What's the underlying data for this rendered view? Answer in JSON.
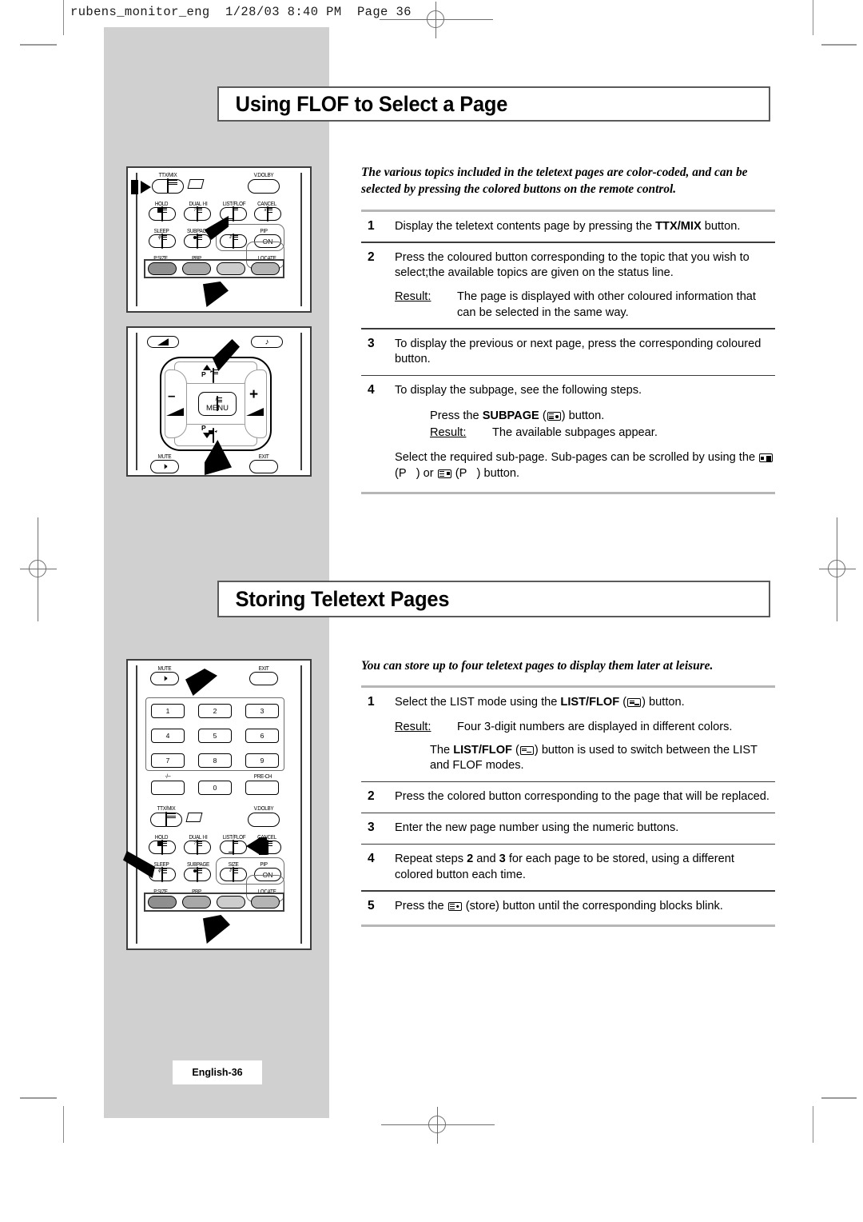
{
  "print_header": "rubens_monitor_eng  1/28/03 8:40 PM  Page 36",
  "sections": [
    {
      "title": "Using FLOF to Select a Page",
      "intro": "The various topics included in the teletext pages are color-coded, and can be selected by pressing the colored buttons on the remote control.",
      "steps": [
        {
          "num": "1",
          "text_before": "Display the teletext contents page by pressing the ",
          "bold": "TTX/MIX",
          "text_after": " button."
        },
        {
          "num": "2",
          "text": "Press the coloured button corresponding to the topic that you wish to select;the available topics are given on the status line.",
          "result_label": "Result:",
          "result_text": "The page is displayed with other coloured information that can be selected in the same way."
        },
        {
          "num": "3",
          "text": "To display the previous or next page, press the corresponding coloured button."
        },
        {
          "num": "4",
          "text": "To display the subpage, see the following steps.",
          "sub_press_before": "Press the ",
          "sub_press_bold": "SUBPAGE",
          "sub_press_after": ") button.",
          "result_label": "Result:",
          "result_text": "The available subpages appear.",
          "scroll_before": "Select the required sub-page. Sub-pages can be scrolled by using the ",
          "scroll_mid1": "(P",
          "scroll_mid2": ") or",
          "scroll_mid3": "(P",
          "scroll_after": ") button."
        }
      ]
    },
    {
      "title": "Storing Teletext Pages",
      "intro": "You can store up to four teletext pages to display them later at leisure.",
      "steps": [
        {
          "num": "1",
          "text_before": "Select the LIST mode using the ",
          "bold": "LIST/FLOF",
          "text_after": ") button.",
          "result_label": "Result:",
          "result_text": "Four 3-digit numbers are displayed in different colors.",
          "note_before": "The ",
          "note_bold": "LIST/FLOF",
          "note_after": ") button is used to switch between the LIST and FLOF modes."
        },
        {
          "num": "2",
          "text": "Press the colored button corresponding to the page that will be replaced."
        },
        {
          "num": "3",
          "text": "Enter the new page number using the numeric buttons."
        },
        {
          "num": "4",
          "text_a": "Repeat steps ",
          "bold_a": "2",
          "text_b": " and ",
          "bold_b": "3",
          "text_c": " for each page to be stored, using a different colored button each time."
        },
        {
          "num": "5",
          "text_before": "Press the ",
          "text_after": " (store) button until the corresponding blocks blink."
        }
      ]
    }
  ],
  "remotes": {
    "top": {
      "labels": {
        "ttxmix": "TTX/MIX",
        "vdolby": "V.DOLBY",
        "hold": "HOLD",
        "dual": "DUAL I-II",
        "listflof": "LIST/FLOF",
        "cancel": "CANCEL",
        "sleep": "SLEEP",
        "subpage": "SUBPAGE",
        "size": "SIZE",
        "pip": "PIP",
        "pipon": "ON",
        "psize": "P.SIZE",
        "pbp": "PBP",
        "locate": "LOCATE"
      }
    },
    "middle": {
      "labels": {
        "p_up": "P",
        "p_down": "P",
        "menu": "MENU",
        "minus": "–",
        "plus": "+",
        "mute": "MUTE",
        "exit": "EXIT"
      }
    },
    "bottom": {
      "labels": {
        "mute": "MUTE",
        "exit": "EXIT",
        "k1": "1",
        "k2": "2",
        "k3": "3",
        "k4": "4",
        "k5": "5",
        "k6": "6",
        "k7": "7",
        "k8": "8",
        "k9": "9",
        "kdash": "-/--",
        "k0": "0",
        "prech": "PRE-CH",
        "ttxmix": "TTX/MIX",
        "vdolby": "V.DOLBY",
        "hold": "HOLD",
        "dual": "DUAL I-II",
        "listflof": "LIST/FLOF",
        "cancel": "CANCEL",
        "sleep": "SLEEP",
        "subpage": "SUBPAGE",
        "size": "SIZE",
        "pip": "PIP",
        "pipon": "ON",
        "psize": "P.SIZE",
        "pbp": "PBP",
        "locate": "LOCATE"
      }
    }
  },
  "footer": {
    "page_label": "English-36"
  },
  "colors": {
    "band_gray": "#d0d0d0",
    "rule_gray": "#b6b6b6",
    "rule_dark": "#3b3b3b",
    "title_border": "#5a5a5a"
  }
}
